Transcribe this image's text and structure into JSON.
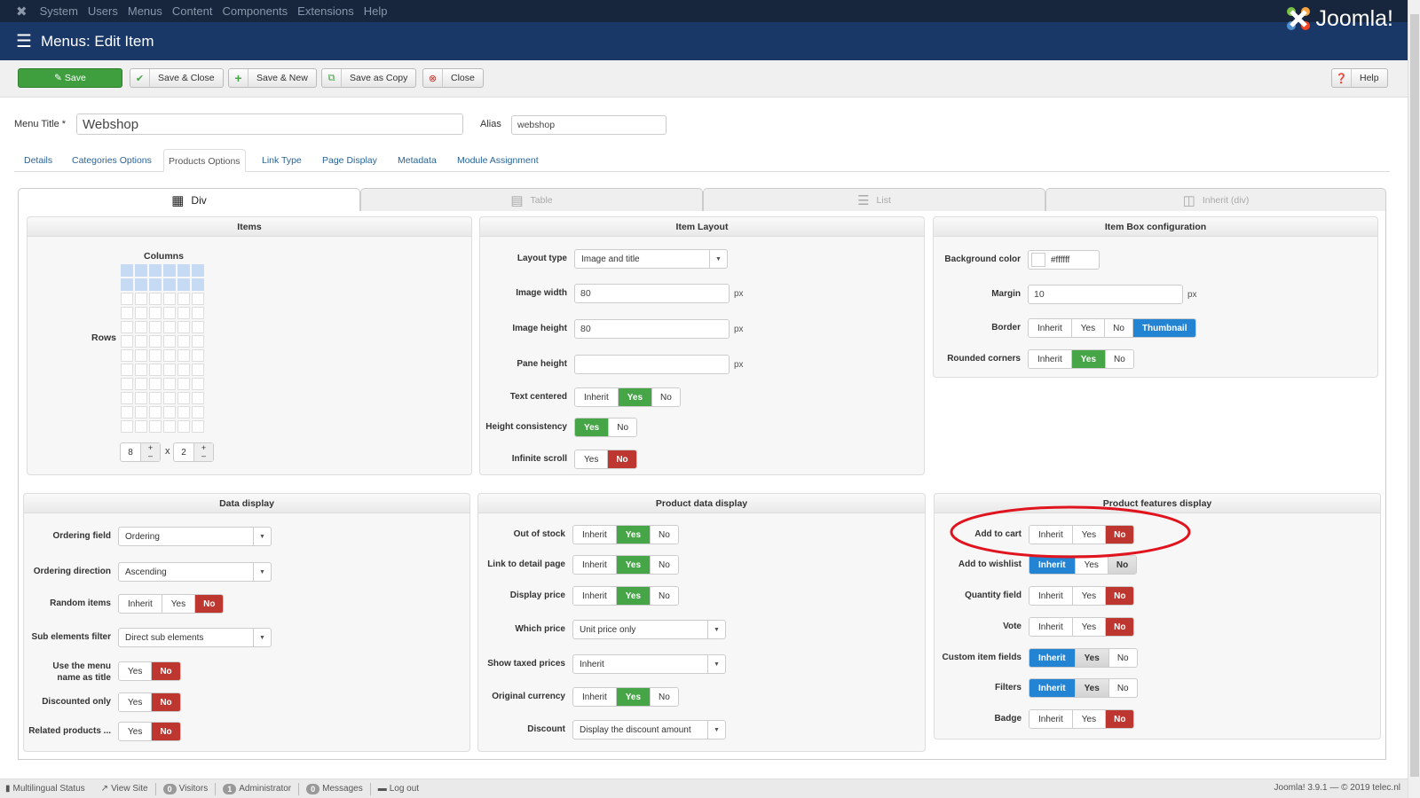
{
  "topnav": {
    "items": [
      "System",
      "Users",
      "Menus",
      "Content",
      "Components",
      "Extensions",
      "Help"
    ]
  },
  "header": {
    "title": "Menus: Edit Item",
    "brand": "Joomla!"
  },
  "toolbar": {
    "save": "Save",
    "save_close": "Save & Close",
    "save_new": "Save & New",
    "save_copy": "Save as Copy",
    "close": "Close",
    "help": "Help"
  },
  "form": {
    "menu_title_label": "Menu Title *",
    "menu_title_value": "Webshop",
    "alias_label": "Alias",
    "alias_value": "webshop"
  },
  "tabs": [
    "Details",
    "Categories Options",
    "Products Options",
    "Link Type",
    "Page Display",
    "Metadata",
    "Module Assignment"
  ],
  "active_tab": "Products Options",
  "layout_tabs": [
    "Div",
    "Table",
    "List",
    "Inherit (div)"
  ],
  "colors": {
    "green": "#46a546",
    "red": "#bd362f",
    "blue": "#2384d3",
    "header": "#1a3867",
    "annotation": "#e0141e"
  },
  "items_panel": {
    "title": "Items",
    "columns_label": "Columns",
    "rows_label": "Rows",
    "rows_value": "8",
    "cols_value": "2",
    "times": "x",
    "plus": "+",
    "minus": "–",
    "grid_columns": 6,
    "grid_rows": 12,
    "highlighted_rows": 2
  },
  "panels": [
    {
      "title": "Item Layout",
      "rows": [
        {
          "label": "Layout type",
          "type": "select",
          "value": "Image and title"
        },
        {
          "label": "Image width",
          "type": "input",
          "value": "80",
          "suffix": "px"
        },
        {
          "label": "Image height",
          "type": "input",
          "value": "80",
          "suffix": "px"
        },
        {
          "label": "Pane height",
          "type": "input",
          "value": "",
          "suffix": "px"
        },
        {
          "label": "Text centered",
          "type": "toggle",
          "options": [
            "Inherit",
            "Yes",
            "No"
          ],
          "active": "Yes",
          "style": "green"
        },
        {
          "label": "Height consistency",
          "type": "toggle",
          "options": [
            "Yes",
            "No"
          ],
          "active": "Yes",
          "style": "green"
        },
        {
          "label": "Infinite scroll",
          "type": "toggle",
          "options": [
            "Yes",
            "No"
          ],
          "active": "No",
          "style": "red"
        }
      ]
    },
    {
      "title": "Item Box configuration",
      "rows": [
        {
          "label": "Background color",
          "type": "color",
          "value": "#ffffff"
        },
        {
          "label": "Margin",
          "type": "input",
          "value": "10",
          "suffix": "px"
        },
        {
          "label": "Border",
          "type": "toggle",
          "options": [
            "Inherit",
            "Yes",
            "No",
            "Thumbnail"
          ],
          "active": "Thumbnail",
          "style": "blue"
        },
        {
          "label": "Rounded corners",
          "type": "toggle",
          "options": [
            "Inherit",
            "Yes",
            "No"
          ],
          "active": "Yes",
          "style": "green"
        }
      ]
    },
    {
      "title": "Data display",
      "rows": [
        {
          "label": "Ordering field",
          "type": "select",
          "value": "Ordering"
        },
        {
          "label": "Ordering direction",
          "type": "select",
          "value": "Ascending"
        },
        {
          "label": "Random items",
          "type": "toggle",
          "options": [
            "Inherit",
            "Yes",
            "No"
          ],
          "active": "No",
          "style": "red"
        },
        {
          "label": "Sub elements filter",
          "type": "select",
          "value": "Direct sub elements"
        },
        {
          "label": "Use the menu name as title",
          "type": "toggle",
          "options": [
            "Yes",
            "No"
          ],
          "active": "No",
          "style": "red"
        },
        {
          "label": "Discounted only",
          "type": "toggle",
          "options": [
            "Yes",
            "No"
          ],
          "active": "No",
          "style": "red"
        },
        {
          "label": "Related products ...",
          "type": "toggle",
          "options": [
            "Yes",
            "No"
          ],
          "active": "No",
          "style": "red"
        }
      ]
    },
    {
      "title": "Product data display",
      "rows": [
        {
          "label": "Out of stock",
          "type": "toggle",
          "options": [
            "Inherit",
            "Yes",
            "No"
          ],
          "active": "Yes",
          "style": "green"
        },
        {
          "label": "Link to detail page",
          "type": "toggle",
          "options": [
            "Inherit",
            "Yes",
            "No"
          ],
          "active": "Yes",
          "style": "green"
        },
        {
          "label": "Display price",
          "type": "toggle",
          "options": [
            "Inherit",
            "Yes",
            "No"
          ],
          "active": "Yes",
          "style": "green"
        },
        {
          "label": "Which price",
          "type": "select",
          "value": "Unit price only"
        },
        {
          "label": "Show taxed prices",
          "type": "select",
          "value": "Inherit"
        },
        {
          "label": "Original currency",
          "type": "toggle",
          "options": [
            "Inherit",
            "Yes",
            "No"
          ],
          "active": "Yes",
          "style": "green"
        },
        {
          "label": "Discount",
          "type": "select",
          "value": "Display the discount amount"
        }
      ]
    },
    {
      "title": "Product features display",
      "rows": [
        {
          "label": "Add to cart",
          "type": "toggle",
          "options": [
            "Inherit",
            "Yes",
            "No"
          ],
          "active": "No",
          "style": "red"
        },
        {
          "label": "Add to wishlist",
          "type": "toggle",
          "options": [
            "Inherit",
            "Yes",
            "No"
          ],
          "active": "Inherit",
          "style": "blue",
          "secondary": "No"
        },
        {
          "label": "Quantity field",
          "type": "toggle",
          "options": [
            "Inherit",
            "Yes",
            "No"
          ],
          "active": "No",
          "style": "red"
        },
        {
          "label": "Vote",
          "type": "toggle",
          "options": [
            "Inherit",
            "Yes",
            "No"
          ],
          "active": "No",
          "style": "red"
        },
        {
          "label": "Custom item fields",
          "type": "toggle",
          "options": [
            "Inherit",
            "Yes",
            "No"
          ],
          "active": "Inherit",
          "style": "blue",
          "secondary": "Yes"
        },
        {
          "label": "Filters",
          "type": "toggle",
          "options": [
            "Inherit",
            "Yes",
            "No"
          ],
          "active": "Inherit",
          "style": "blue",
          "secondary": "Yes"
        },
        {
          "label": "Badge",
          "type": "toggle",
          "options": [
            "Inherit",
            "Yes",
            "No"
          ],
          "active": "No",
          "style": "red"
        }
      ]
    }
  ],
  "status": {
    "multilingual": "Multilingual Status",
    "view_site": "View Site",
    "visitors_count": "0",
    "visitors": "Visitors",
    "admin_count": "1",
    "admin": "Administrator",
    "messages_count": "0",
    "messages": "Messages",
    "logout": "Log out",
    "copyright": "Joomla! 3.9.1 — © 2019 telec.nl"
  }
}
